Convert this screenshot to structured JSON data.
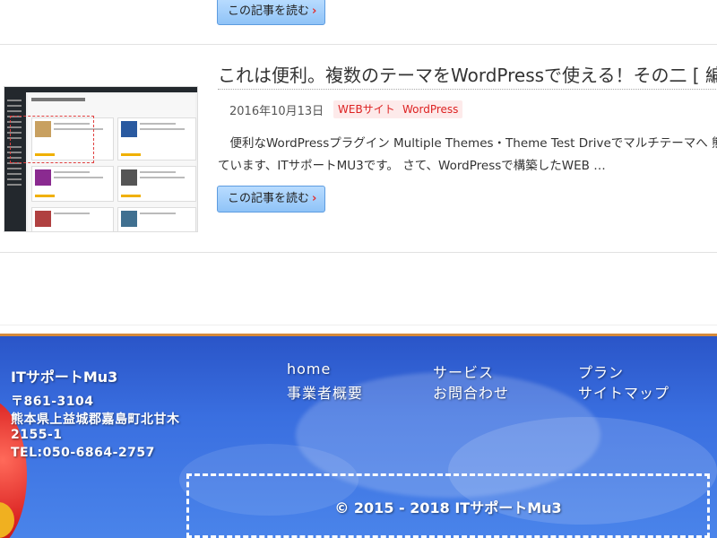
{
  "posts": [
    {
      "read_more_label": "この記事を読む"
    },
    {
      "title": "これは便利。複数のテーマをWordPressで使える！その二 [ 編集",
      "date": "2016年10月13日",
      "tags": [
        "WEBサイト",
        "WordPress"
      ],
      "excerpt_lines": [
        "　便利なWordPressプラグイン Multiple Themes・Theme Test Driveでマルチテーマへ 熊",
        "ています、ITサポートMU3です。 さて、WordPressで構築したWEB …"
      ],
      "read_more_label": "この記事を読む"
    }
  ],
  "read_more_arrow": "›",
  "footer": {
    "company": "ITサポートMu3",
    "address_lines": [
      "〒861-3104",
      "熊本県上益城郡嘉島町北甘木",
      "2155-1",
      "TEL:050-6864-2757"
    ],
    "nav": [
      "home",
      "サービス",
      "プラン",
      "事業者概要",
      "お問合わせ",
      "サイトマップ"
    ],
    "copyright": "© 2015 - 2018  ITサポートMu3"
  },
  "colors": {
    "tag_text": "#dd2222",
    "button_bg": "#9fcdfa",
    "footer_border": "#d58a3a",
    "footer_bg": "#3a6fe0"
  }
}
